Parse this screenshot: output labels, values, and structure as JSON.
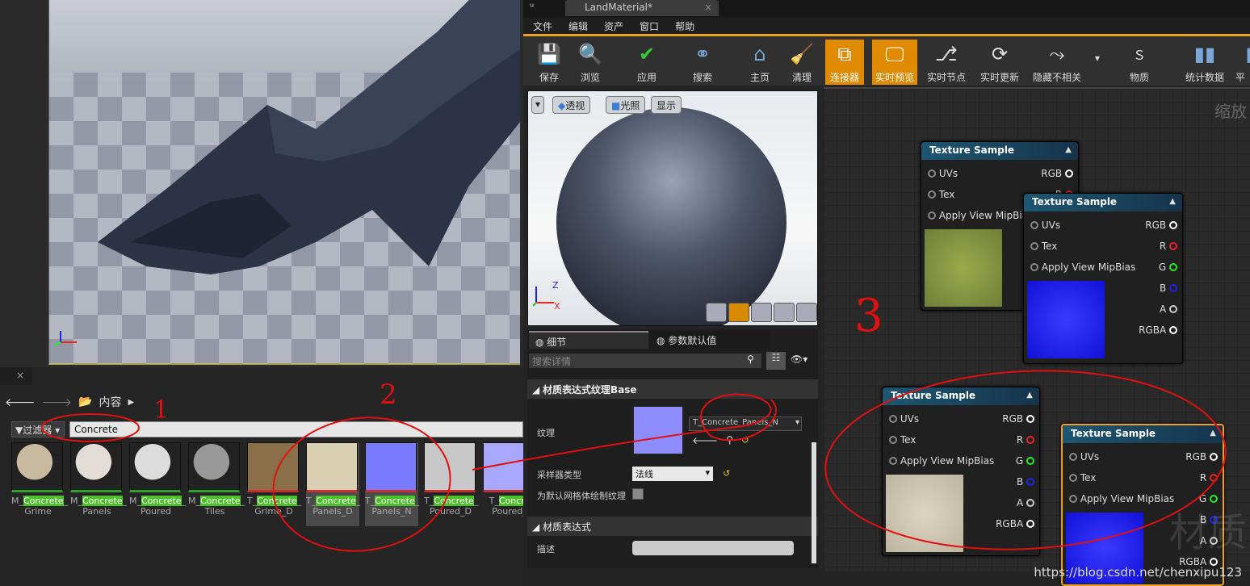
{
  "content_browser": {
    "tab_close": "×",
    "breadcrumb": "内容",
    "filter_label": "过滤器",
    "search_value": "Concrete",
    "assets": [
      {
        "pre": "M_",
        "hl": "Concrete",
        "post": "_",
        "line2": "Grime"
      },
      {
        "pre": "M_",
        "hl": "Concrete",
        "post": "_",
        "line2": "Panels"
      },
      {
        "pre": "M_",
        "hl": "Concrete",
        "post": "_",
        "line2": "Poured"
      },
      {
        "pre": "M_",
        "hl": "Concrete",
        "post": "_",
        "line2": "Tiles"
      },
      {
        "pre": "T_",
        "hl": "Concrete",
        "post": "_",
        "line2": "Grime_D"
      },
      {
        "pre": "T_",
        "hl": "Concrete",
        "post": "_",
        "line2": "Panels_D"
      },
      {
        "pre": "T_",
        "hl": "Concrete",
        "post": "_",
        "line2": "Panels_N"
      },
      {
        "pre": "T_",
        "hl": "Concrete",
        "post": "_",
        "line2": "Poured_D"
      },
      {
        "pre": "T_",
        "hl": "Concre",
        "post": "",
        "line2": "Poured_"
      }
    ]
  },
  "material_editor": {
    "tab_title": "LandMaterial*",
    "menu": [
      "文件",
      "编辑",
      "资产",
      "窗口",
      "帮助"
    ],
    "toolbar": [
      "保存",
      "浏览",
      "应用",
      "搜索",
      "主页",
      "清理",
      "连接器",
      "实时预览",
      "实时节点",
      "实时更新",
      "隐藏不相关",
      "物质",
      "统计数据",
      "平台"
    ],
    "preview_buttons": {
      "perspective": "透视",
      "lit": "光照",
      "show": "显示"
    },
    "details_tabs": [
      "细节",
      "参数默认值"
    ],
    "search_placeholder": "搜索详情",
    "section1": "材质表达式纹理Base",
    "texture_label": "纹理",
    "texture_value": "T_Concrete_Panels_N",
    "sampler_label": "采样器类型",
    "sampler_value": "法线",
    "default_mesh_label": "为默认网格体绘制纹理",
    "section2": "材质表达式",
    "description_label": "描述",
    "graph_zoom": "缩放"
  },
  "nodes": {
    "title": "Texture Sample",
    "inputs": [
      "UVs",
      "Tex",
      "Apply View MipBias"
    ],
    "outputs": [
      "RGB",
      "R",
      "G",
      "B",
      "A",
      "RGBA"
    ]
  },
  "annotations": [
    "1",
    "2",
    "3"
  ],
  "watermark": "https://blog.csdn.net/chenxipu123",
  "watermark_logo": "材质"
}
